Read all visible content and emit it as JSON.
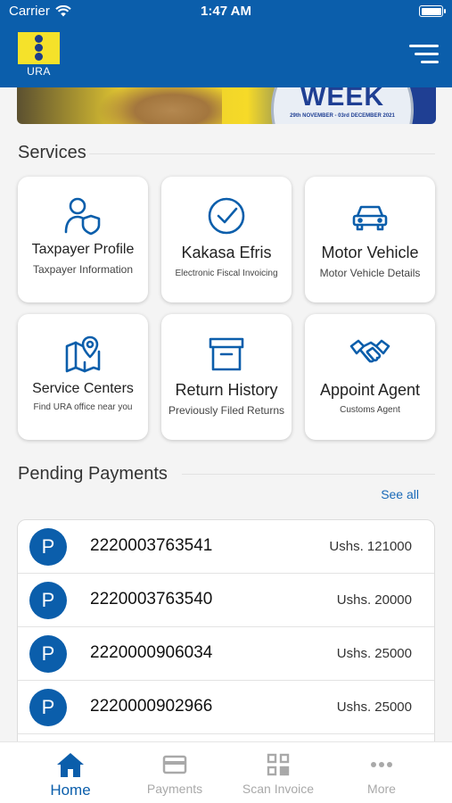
{
  "status_bar": {
    "carrier": "Carrier",
    "time": "1:47 AM"
  },
  "header": {
    "logo_text": "URA"
  },
  "banner": {
    "headline": "WEEK",
    "dates": "29th NOVEMBER - 03rd DECEMBER 2021"
  },
  "services": {
    "title": "Services",
    "items": [
      {
        "title": "Taxpayer Profile",
        "subtitle": "Taxpayer Information",
        "icon": "user-shield-icon"
      },
      {
        "title": "Kakasa Efris",
        "subtitle": "Electronic Fiscal Invoicing",
        "icon": "check-circle-icon"
      },
      {
        "title": "Motor Vehicle",
        "subtitle": "Motor Vehicle Details",
        "icon": "car-icon"
      },
      {
        "title": "Service Centers",
        "subtitle": "Find URA office near you",
        "icon": "map-pin-icon"
      },
      {
        "title": "Return History",
        "subtitle": "Previously Filed Returns",
        "icon": "archive-box-icon"
      },
      {
        "title": "Appoint Agent",
        "subtitle": "Customs Agent",
        "icon": "handshake-icon"
      }
    ]
  },
  "pending_payments": {
    "title": "Pending Payments",
    "see_all": "See all",
    "badge_letter": "P",
    "rows": [
      {
        "prn": "2220003763541",
        "amount": "Ushs. 121000"
      },
      {
        "prn": "2220003763540",
        "amount": "Ushs. 20000"
      },
      {
        "prn": "2220000906034",
        "amount": "Ushs. 25000"
      },
      {
        "prn": "2220000902966",
        "amount": "Ushs. 25000"
      }
    ]
  },
  "tabbar": {
    "tabs": [
      {
        "label": "Home",
        "icon": "home-icon",
        "active": true
      },
      {
        "label": "Payments",
        "icon": "card-icon",
        "active": false
      },
      {
        "label": "Scan Invoice",
        "icon": "qr-code-icon",
        "active": false
      },
      {
        "label": "More",
        "icon": "more-dots-icon",
        "active": false
      }
    ]
  },
  "colors": {
    "primary": "#0b5eab",
    "logo_yellow": "#f5e22a",
    "background": "#f4f4f4"
  }
}
